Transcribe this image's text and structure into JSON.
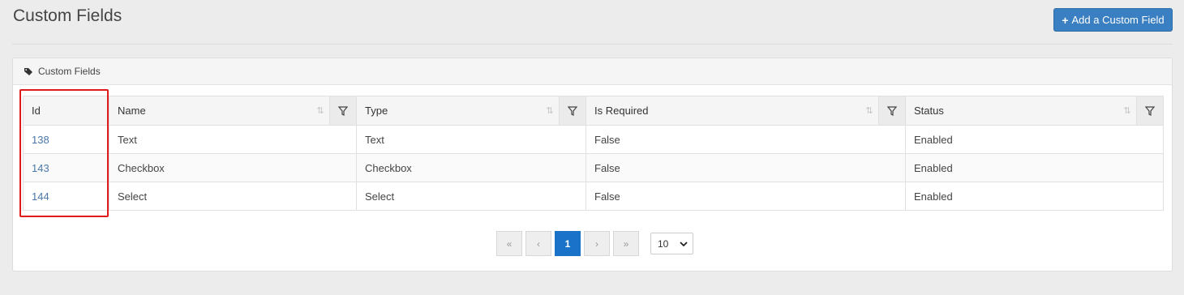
{
  "header": {
    "title": "Custom Fields",
    "add_button_label": "Add a Custom Field"
  },
  "panel": {
    "title": "Custom Fields"
  },
  "table": {
    "columns": [
      "Id",
      "Name",
      "Type",
      "Is Required",
      "Status"
    ],
    "rows": [
      {
        "id": "138",
        "name": "Text",
        "type": "Text",
        "is_required": "False",
        "status": "Enabled"
      },
      {
        "id": "143",
        "name": "Checkbox",
        "type": "Checkbox",
        "is_required": "False",
        "status": "Enabled"
      },
      {
        "id": "144",
        "name": "Select",
        "type": "Select",
        "is_required": "False",
        "status": "Enabled"
      }
    ]
  },
  "pagination": {
    "first": "«",
    "prev": "‹",
    "current_page": "1",
    "next": "›",
    "last": "»",
    "page_size": "10"
  },
  "colors": {
    "accent": "#1a73c9",
    "button": "#3a7fc1",
    "highlight": "#e01b1b",
    "link": "#4a78a8"
  }
}
